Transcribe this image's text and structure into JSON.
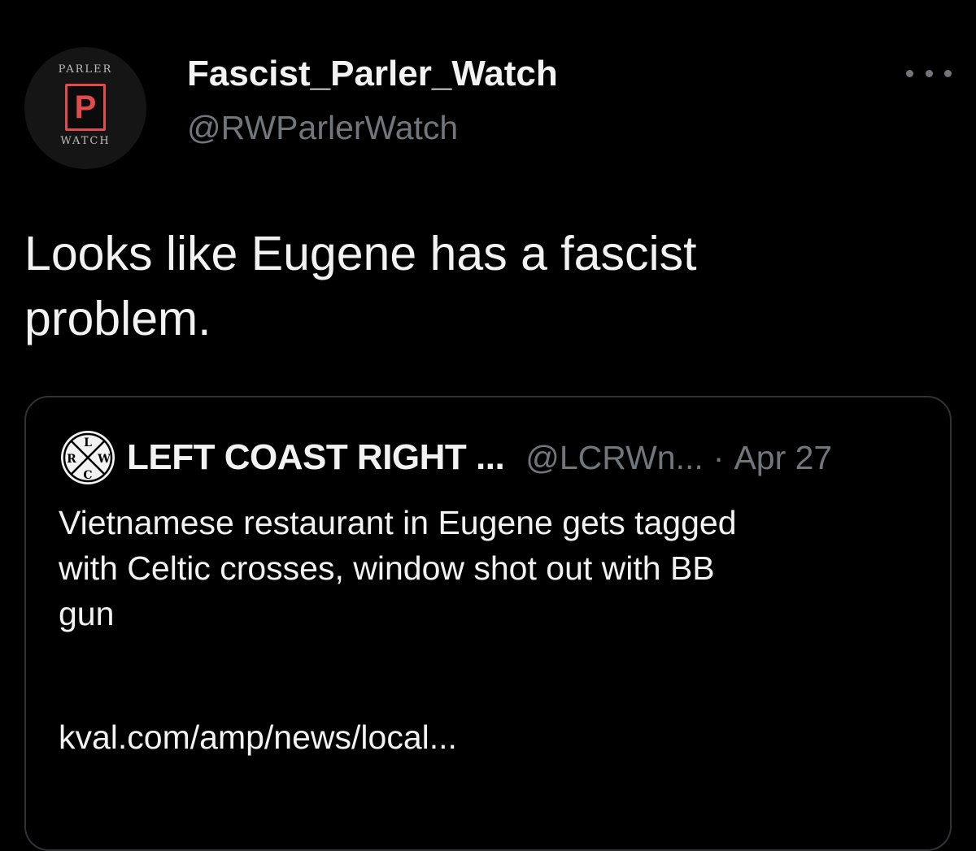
{
  "tweet": {
    "avatar": {
      "top_text": "PARLER",
      "logo_letter": "P",
      "bottom_text": "WATCH",
      "icon": "parler-watch-logo-icon",
      "accent_color": "#e14b4b"
    },
    "display_name": "Fascist_Parler_Watch",
    "handle": "@RWParlerWatch",
    "more_icon": "more-horizontal-icon",
    "text_line1": "Looks like Eugene has a fascist",
    "text_line2": "problem."
  },
  "quoted_tweet": {
    "avatar_icon": "lcrw-logo-icon",
    "avatar_letters": [
      "L",
      "C",
      "R",
      "W"
    ],
    "display_name": "LEFT COAST RIGHT ...",
    "handle": "@LCRWn...",
    "separator": "·",
    "date": "Apr 27",
    "text_line1": "Vietnamese restaurant in Eugene gets tagged",
    "text_line2": "with Celtic crosses, window shot out with BB",
    "text_line3": "gun",
    "link": "kval.com/amp/news/local..."
  },
  "colors": {
    "background": "#000000",
    "primary_text": "#f2f2f2",
    "secondary_text": "#71767b",
    "border": "#2f3336"
  }
}
